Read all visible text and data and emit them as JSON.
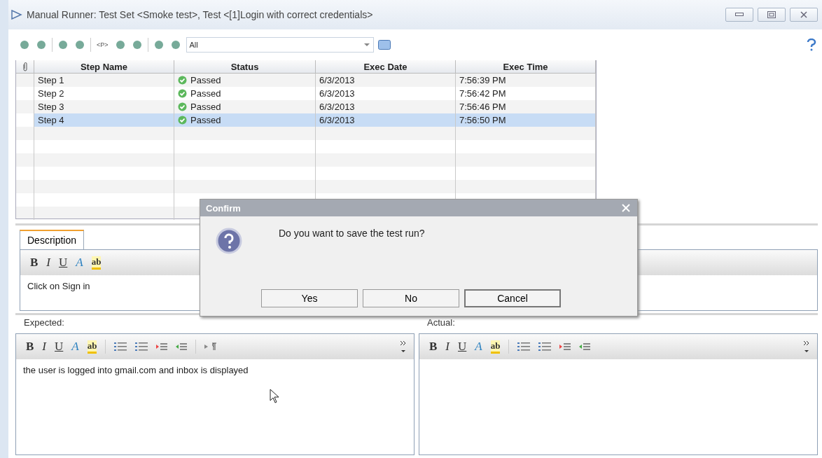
{
  "window": {
    "title": "Manual Runner: Test Set <Smoke test>, Test <[1]Login with correct credentials>"
  },
  "toolbar": {
    "param_label": "<P>",
    "filter": {
      "value": "All"
    }
  },
  "table": {
    "columns": [
      "Step Name",
      "Status",
      "Exec Date",
      "Exec Time"
    ],
    "rows": [
      {
        "step": "Step 1",
        "status": "Passed",
        "date": "6/3/2013",
        "time": "7:56:39 PM",
        "selected": false
      },
      {
        "step": "Step 2",
        "status": "Passed",
        "date": "6/3/2013",
        "time": "7:56:42 PM",
        "selected": false
      },
      {
        "step": "Step 3",
        "status": "Passed",
        "date": "6/3/2013",
        "time": "7:56:46 PM",
        "selected": false
      },
      {
        "step": "Step 4",
        "status": "Passed",
        "date": "6/3/2013",
        "time": "7:56:50 PM",
        "selected": true
      }
    ]
  },
  "description": {
    "tabs": [
      {
        "label": "Description",
        "selected": true
      }
    ],
    "format_glyphs": [
      "B",
      "I",
      "U",
      "A",
      "ab"
    ],
    "text": "Click on Sign in"
  },
  "expected": {
    "label": "Expected:",
    "format_glyphs": [
      "B",
      "I",
      "U",
      "A",
      "ab"
    ],
    "text": "the user is logged into gmail.com and inbox is displayed"
  },
  "actual": {
    "label": "Actual:",
    "format_glyphs": [
      "B",
      "I",
      "U",
      "A",
      "ab"
    ]
  },
  "dialog": {
    "title": "Confirm",
    "message": "Do you want to save the test run?",
    "buttons": [
      {
        "label": "Yes",
        "focused": false
      },
      {
        "label": "No",
        "focused": false
      },
      {
        "label": "Cancel",
        "focused": true
      }
    ]
  }
}
